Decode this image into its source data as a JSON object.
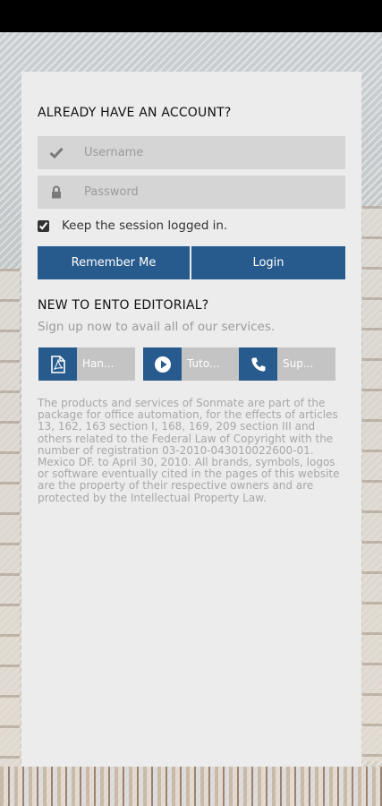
{
  "login": {
    "heading": "ALREADY HAVE AN ACCOUNT?",
    "username_placeholder": "Username",
    "password_placeholder": "Password",
    "keep_session_label": "Keep the session logged in.",
    "keep_session_checked": true,
    "remember_button": "Remember Me",
    "login_button": "Login"
  },
  "signup": {
    "heading": "NEW TO ENTO EDITORIAL?",
    "subtitle": "Sign up now to avail all of our services."
  },
  "tiles": [
    {
      "label": "Han...",
      "icon": "pdf-icon"
    },
    {
      "label": "Tuto...",
      "icon": "play-icon"
    },
    {
      "label": "Sup...",
      "icon": "phone-icon"
    }
  ],
  "legal_text": "The products and services of Sonmate are part of the package for office automation, for the effects of articles 13, 162, 163 section I, 168, 169, 209 section III and others related to the Federal Law of Copyright with the number of registration 03-2010-043010022600-01. Mexico DF. to April 30, 2010. All brands, symbols, logos or software eventually cited in the pages of this website are the property of their respective owners and are protected by the Intellectual Property Law.",
  "colors": {
    "accent": "#275a8d",
    "card": "#ececec",
    "field": "#d5d5d5",
    "tile": "#c4c4c4"
  }
}
